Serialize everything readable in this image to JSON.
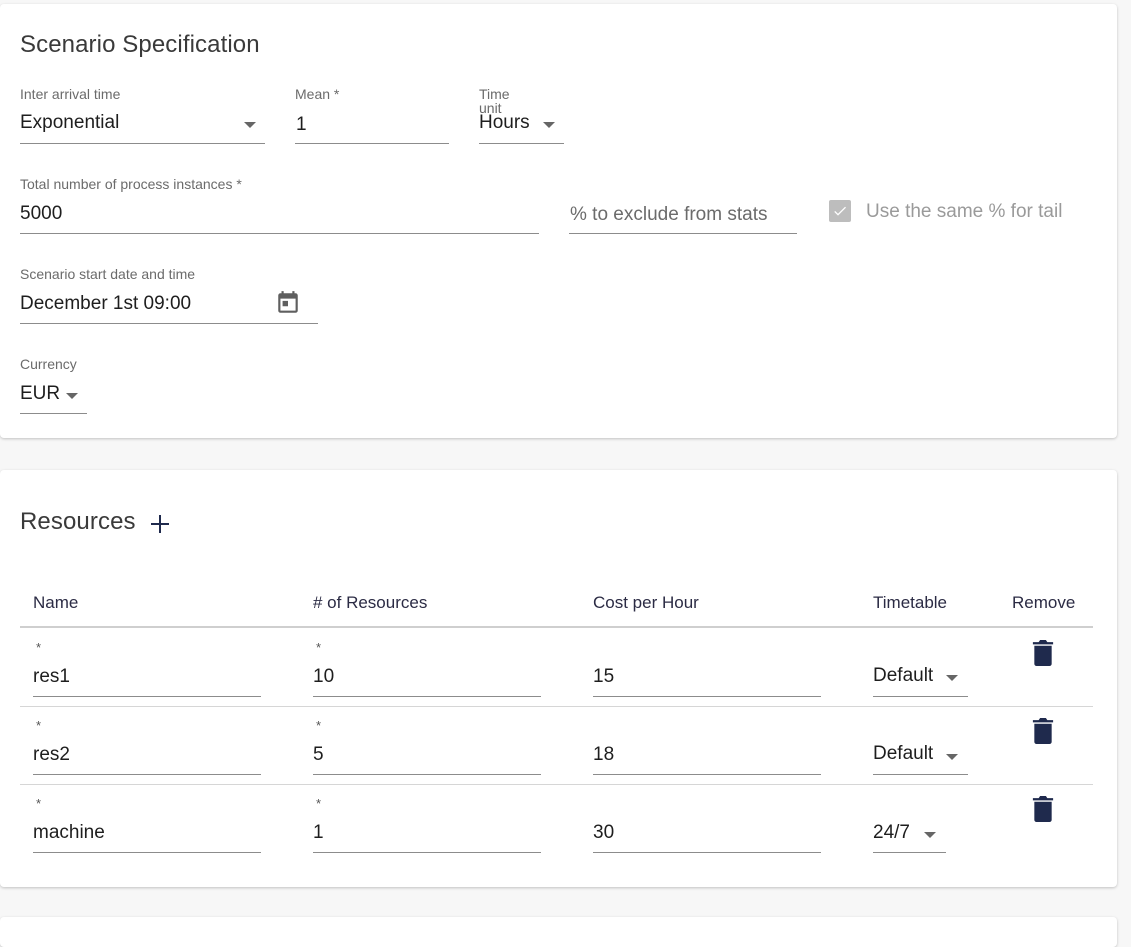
{
  "scenario": {
    "title": "Scenario Specification",
    "inter_arrival": {
      "label": "Inter arrival time",
      "value": "Exponential"
    },
    "mean": {
      "label": "Mean *",
      "value": "1"
    },
    "time_unit": {
      "label_line1": "Time",
      "label_line2": "unit",
      "value": "Hours"
    },
    "total_instances": {
      "label": "Total number of process instances *",
      "value": "5000"
    },
    "exclude_pct": {
      "placeholder": "% to exclude from stats"
    },
    "same_tail": {
      "label": "Use the same % for tail",
      "checked": true
    },
    "start_datetime": {
      "label": "Scenario start date and time",
      "value": "December 1st 09:00"
    },
    "currency": {
      "label": "Currency",
      "value": "EUR"
    }
  },
  "resources": {
    "title": "Resources",
    "columns": [
      "Name",
      "# of Resources",
      "Cost per Hour",
      "Timetable",
      "Remove"
    ],
    "rows": [
      {
        "name": "res1",
        "count": "10",
        "cost": "15",
        "timetable": "Default"
      },
      {
        "name": "res2",
        "count": "5",
        "cost": "18",
        "timetable": "Default"
      },
      {
        "name": "machine",
        "count": "1",
        "cost": "30",
        "timetable": "24/7"
      }
    ],
    "required_mark": "*"
  },
  "colors": {
    "accent": "#1f2a4d",
    "checkbox": "#bdbdbd",
    "underline": "#8c8c8c"
  }
}
